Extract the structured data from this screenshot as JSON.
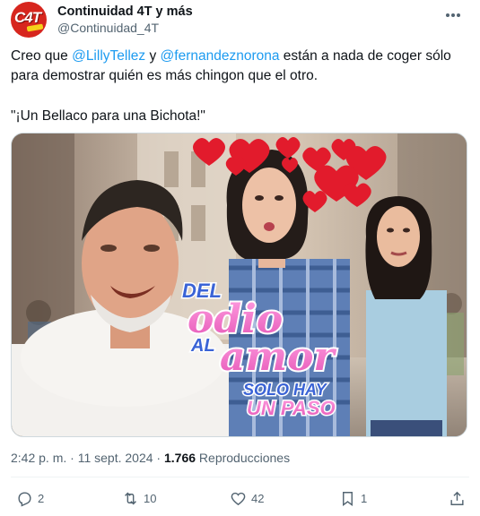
{
  "author": {
    "display_name": "Continuidad 4T y más",
    "handle": "@Continuidad_4T",
    "avatar_text": "C4T",
    "avatar_tag": "Más"
  },
  "tweet": {
    "text_before": "Creo que ",
    "mention1": "@LillyTellez",
    "text_middle": " y ",
    "mention2": "@fernandeznorona",
    "text_after": " están a nada de coger sólo para demostrar quién es más chingon que el otro.",
    "quote": "\"¡Un Bellaco para una Bichota!\""
  },
  "media": {
    "overlay_line1": "DEL",
    "overlay_line2": "odio",
    "overlay_line3": "AL",
    "overlay_line4": "amor",
    "overlay_line5": "SOLO HAY",
    "overlay_line6": "UN PASO"
  },
  "meta": {
    "time": "2:42 p. m.",
    "separator1": " · ",
    "date": "11 sept. 2024",
    "separator2": " · ",
    "views": "1.766",
    "views_label": " Reproducciones"
  },
  "actions": {
    "replies": "2",
    "reposts": "10",
    "likes": "42",
    "bookmarks": "1"
  },
  "colors": {
    "link": "#1d9bf0",
    "secondary_text": "#536471",
    "avatar_red": "#d7261e",
    "overlay_pink": "#f06fc6",
    "overlay_blue": "#3a63d6"
  }
}
